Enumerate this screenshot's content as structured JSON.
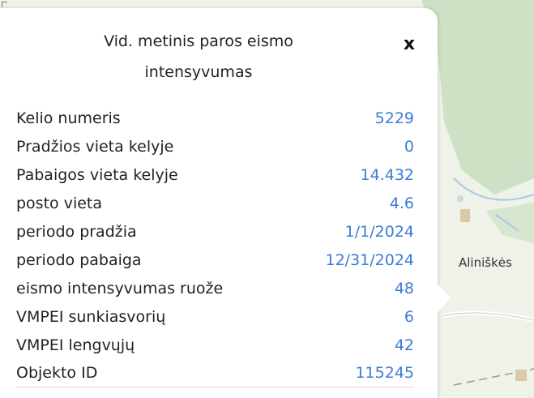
{
  "popup": {
    "title": "Vid. metinis paros eismo intensyvumas",
    "close_label": "x",
    "rows": [
      {
        "key": "Kelio numeris",
        "value": "5229"
      },
      {
        "key": "Pradžios vieta kelyje",
        "value": "0"
      },
      {
        "key": "Pabaigos vieta kelyje",
        "value": "14.432"
      },
      {
        "key": "posto vieta",
        "value": "4.6"
      },
      {
        "key": "periodo pradžia",
        "value": "1/1/2024"
      },
      {
        "key": "periodo pabaiga",
        "value": "12/31/2024"
      },
      {
        "key": "eismo intensyvumas ruože",
        "value": "48"
      },
      {
        "key": "VMPEI sunkiasvorių",
        "value": "6"
      },
      {
        "key": "VMPEI lengvųjų",
        "value": "42"
      },
      {
        "key": "Objekto ID",
        "value": "115245"
      }
    ]
  },
  "map": {
    "place_label": "Aliniškės"
  },
  "colors": {
    "value_text": "#3b7bd6",
    "map_green": "#cfe1c4",
    "map_bg": "#e9efe2"
  }
}
